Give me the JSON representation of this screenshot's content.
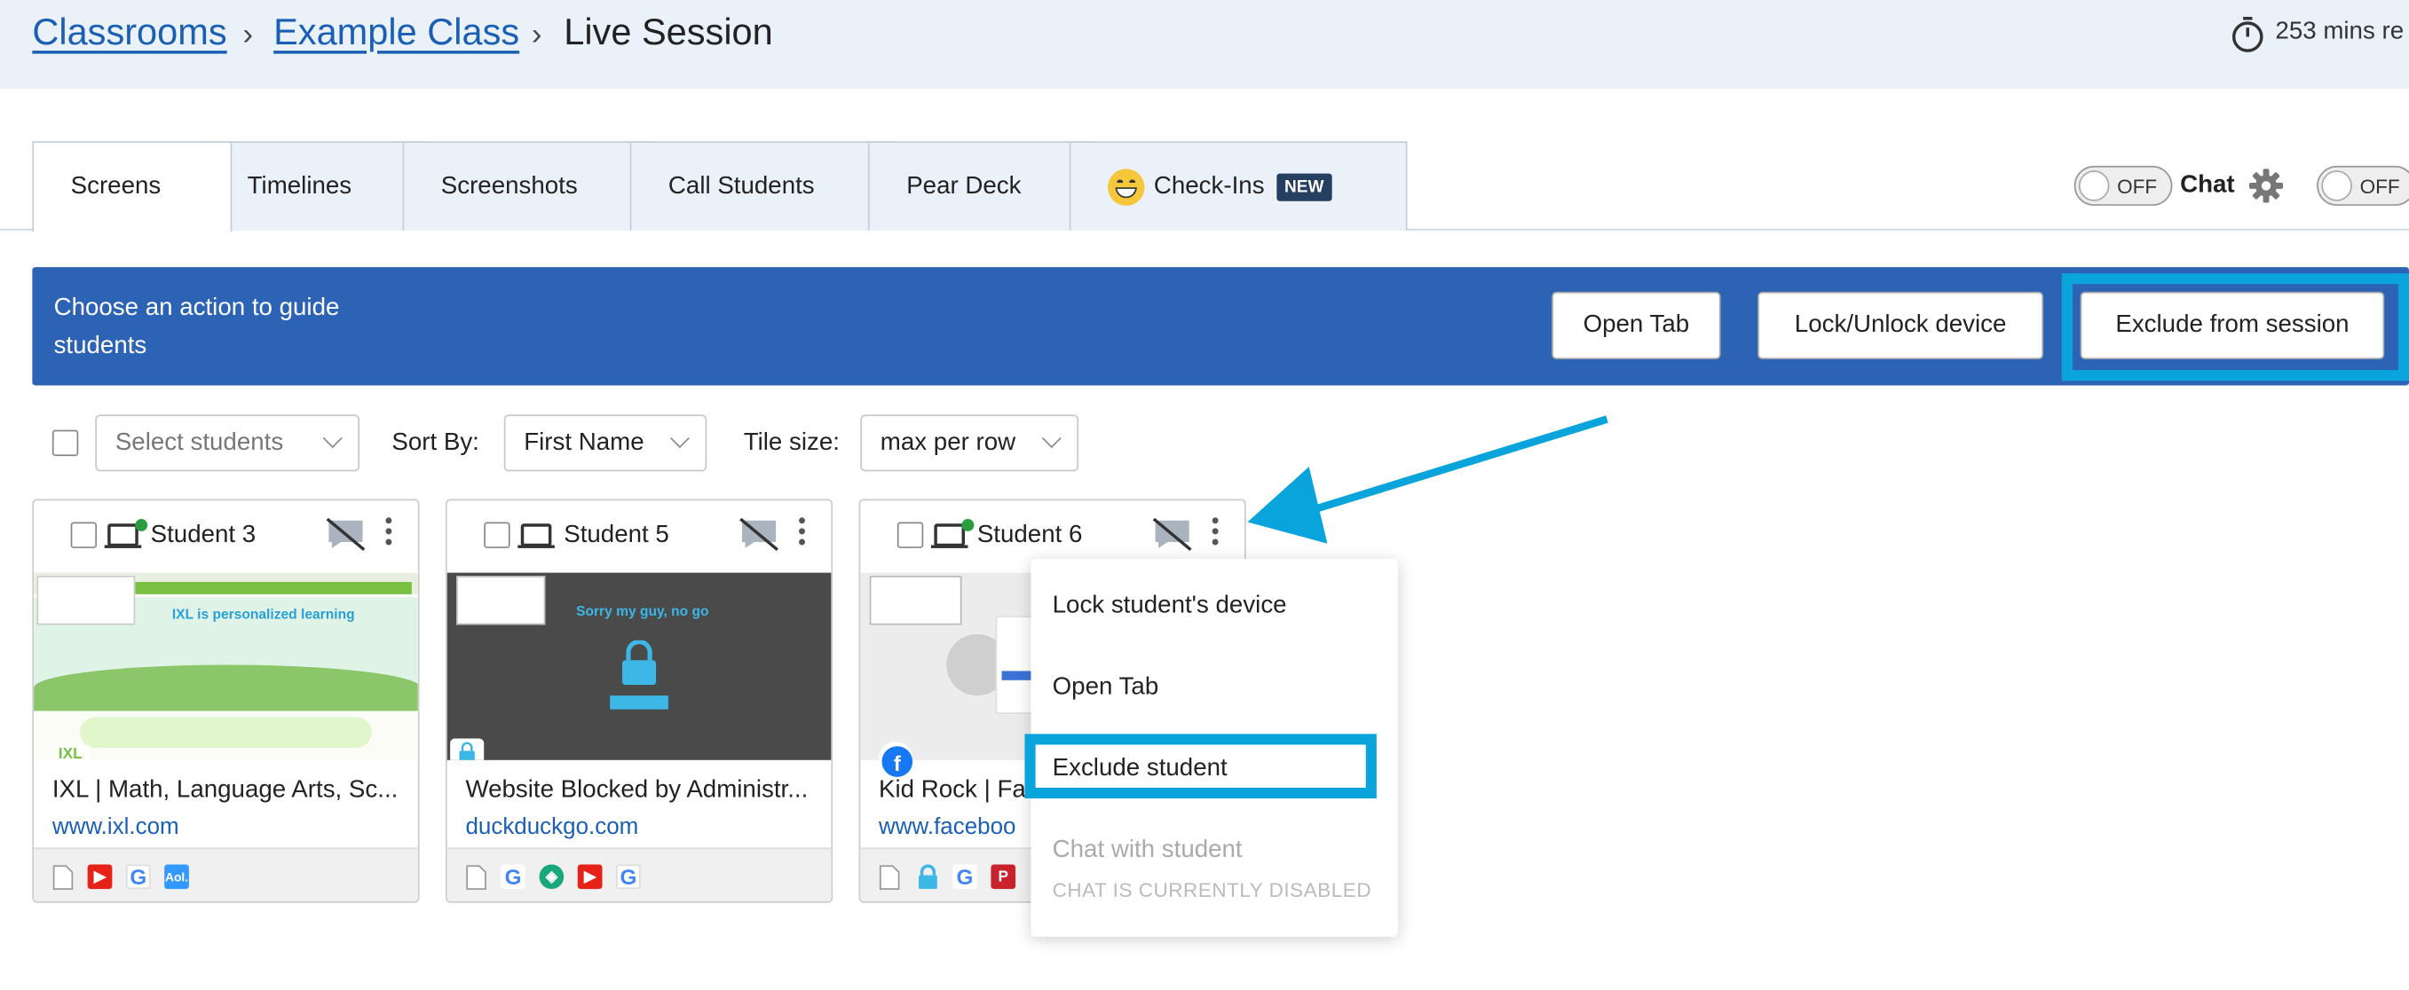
{
  "breadcrumb": {
    "items": [
      "Classrooms",
      "Example Class"
    ],
    "current": "Live Session",
    "timer_text": "253 mins re"
  },
  "tabs": [
    {
      "label": "Screens",
      "active": true
    },
    {
      "label": "Timelines"
    },
    {
      "label": "Screenshots"
    },
    {
      "label": "Call Students"
    },
    {
      "label": "Pear Deck"
    },
    {
      "label": "Check-Ins",
      "badge": "NEW",
      "icon": "grin-emoji-icon"
    }
  ],
  "toolbar_right": {
    "chat_toggle_state": "OFF",
    "chat_label": "Chat",
    "second_toggle_state": "OFF"
  },
  "action_banner": {
    "text": "Choose an action to guide students",
    "buttons": [
      "Open Tab",
      "Lock/Unlock device",
      "Exclude from session"
    ],
    "color": "#2d63b5",
    "highlight_color": "#0aa4dc"
  },
  "controls": {
    "select_students_placeholder": "Select students",
    "sort_label": "Sort By:",
    "sort_value": "First Name",
    "tile_label": "Tile size:",
    "tile_value": "max per row"
  },
  "students": [
    {
      "name": "Student 3",
      "online": true,
      "page_title": "IXL | Math, Language Arts, Sc...",
      "url": "www.ixl.com",
      "site_icon": "ixl",
      "thumb_headline": "IXL is personalized learning",
      "tab_icons": [
        "page-icon",
        "youtube-icon",
        "google-icon",
        "aol-icon"
      ]
    },
    {
      "name": "Student 5",
      "online": false,
      "page_title": "Website Blocked by Administr...",
      "url": "duckduckgo.com",
      "site_icon": "lock",
      "thumb_headline": "Sorry my guy, no go",
      "tab_icons": [
        "page-icon",
        "google-icon",
        "cube-icon",
        "youtube-icon",
        "google-icon"
      ]
    },
    {
      "name": "Student 6",
      "online": true,
      "page_title": "Kid Rock | Fac",
      "url": "www.faceboo",
      "site_icon": "facebook",
      "tab_icons": [
        "page-icon",
        "lock-icon",
        "google-icon",
        "pinterest-icon"
      ]
    }
  ],
  "student_menu": {
    "items": [
      "Lock student's device",
      "Open Tab",
      "Exclude student",
      "Chat with student"
    ],
    "disabled_note": "CHAT IS CURRENTLY DISABLED"
  }
}
